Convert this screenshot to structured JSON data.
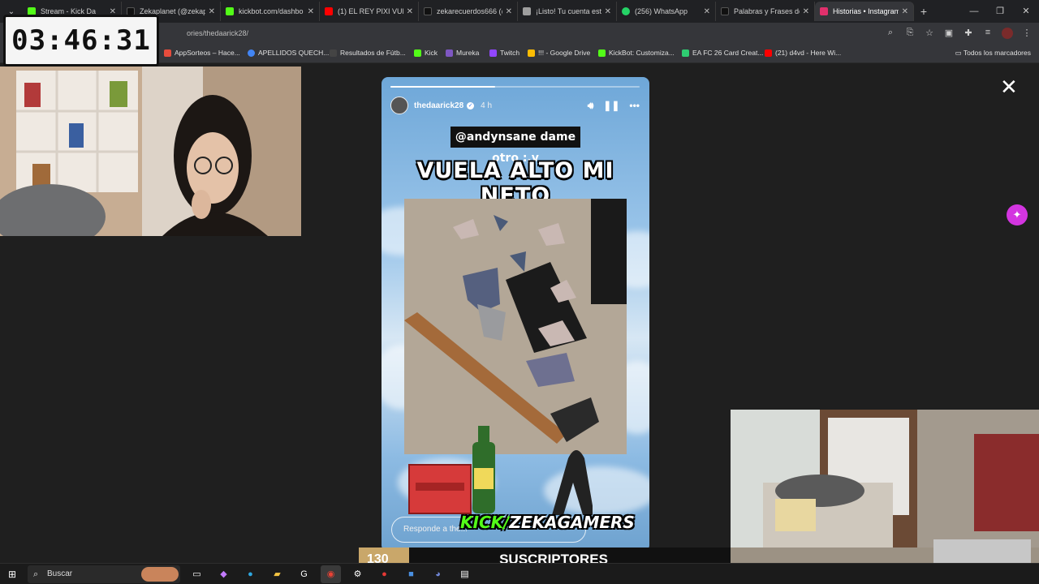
{
  "browser": {
    "tabs": [
      {
        "label": "Stream - Kick Da",
        "color": "#53fc18"
      },
      {
        "label": "Zekaplanet (@zekapl",
        "color": "#111111"
      },
      {
        "label": "kickbot.com/dashbo",
        "color": "#53fc18"
      },
      {
        "label": "(1) EL REY PIXI VUELV",
        "color": "#ff0000"
      },
      {
        "label": "zekarecuerdos666 (@",
        "color": "#111111"
      },
      {
        "label": "¡Listo! Tu cuenta está",
        "color": "#9e9e9e"
      },
      {
        "label": "(256) WhatsApp",
        "color": "#25d366"
      },
      {
        "label": "Palabras y Frases de",
        "color": "#111111"
      },
      {
        "label": "Historias • Instagram",
        "color": "#e1306c"
      }
    ],
    "url": "ories/thedaarick28/",
    "bookmarks": [
      {
        "label": "AppSorteos – Hace...",
        "color": "#e74c3c"
      },
      {
        "label": "APELLIDOS QUECH...",
        "color": "#4285f4"
      },
      {
        "label": "Resultados de Fútb...",
        "color": "#444444"
      },
      {
        "label": "Kick",
        "color": "#53fc18"
      },
      {
        "label": "Mureka",
        "color": "#7e57c2"
      },
      {
        "label": "Twitch",
        "color": "#9146ff"
      },
      {
        "label": "!!! - Google Drive",
        "color": "#fbbc04"
      },
      {
        "label": "KickBot: Customiza...",
        "color": "#53fc18"
      },
      {
        "label": "EA FC 26 Card Creat...",
        "color": "#2ecc71"
      },
      {
        "label": "(21) d4vd - Here Wi...",
        "color": "#ff0000"
      }
    ],
    "all_bookmarks": "Todos los marcadores"
  },
  "timer": "03:46:31",
  "story": {
    "username": "thedaarick28",
    "time_ago": "4 h",
    "progress": 0.42,
    "mention": "@andynsane dame otro :,v",
    "headline": "VUELA ALTO MI NETO",
    "reply_placeholder": "Responde a the..."
  },
  "overlay": {
    "kick_prefix": "KICK/",
    "kick_channel": "ZEKAGAMERS",
    "subs_count": "130",
    "subs_label": "SUSCRIPTORES"
  },
  "taskbar": {
    "search_placeholder": "Buscar"
  }
}
